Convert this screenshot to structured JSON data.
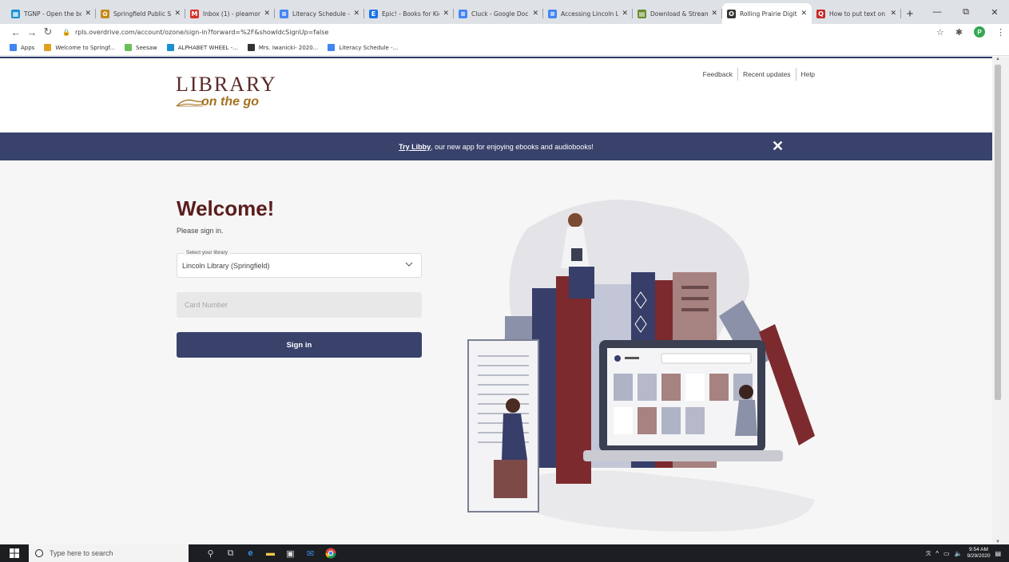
{
  "browser": {
    "tabs": [
      {
        "title": "TGNP - Open the bo",
        "color": "#1b8fd1",
        "glyph": "▦"
      },
      {
        "title": "Springfield Public Sc",
        "color": "#c58a1c",
        "glyph": "✿"
      },
      {
        "title": "Inbox (1) - pleamon",
        "color": "#d93025",
        "glyph": "M"
      },
      {
        "title": "Literacy Schedule -",
        "color": "#4285f4",
        "glyph": "≡"
      },
      {
        "title": "Epic! - Books for Kid",
        "color": "#1a73e8",
        "glyph": "E"
      },
      {
        "title": "Cluck - Google Doc",
        "color": "#4285f4",
        "glyph": "≡"
      },
      {
        "title": "Accessing Lincoln Li",
        "color": "#4285f4",
        "glyph": "≡"
      },
      {
        "title": "Download & Stream",
        "color": "#6a8c2c",
        "glyph": "▤"
      },
      {
        "title": "Rolling Prairie Digit",
        "color": "#333333",
        "glyph": "O"
      },
      {
        "title": "How to put text on",
        "color": "#c62828",
        "glyph": "Q"
      }
    ],
    "active_tab_index": 8,
    "new_tab": "+",
    "url": "rpls.overdrive.com/account/ozone/sign-in?forward=%2F&showIdcSignUp=false",
    "profile_initial": "P",
    "bookmarks": [
      {
        "label": "Apps",
        "color": "#4285f4"
      },
      {
        "label": "Welcome to Springf...",
        "color": "#e0a020"
      },
      {
        "label": "Seesaw",
        "color": "#6bbf59"
      },
      {
        "label": "ALPHABET WHEEL -...",
        "color": "#1b8fd1"
      },
      {
        "label": "Mrs. Iwanicki- 2020...",
        "color": "#333333"
      },
      {
        "label": "Literacy Schedule -...",
        "color": "#4285f4"
      }
    ]
  },
  "header": {
    "logo_top": "LIBRARY",
    "logo_bottom": "on the go",
    "links": [
      "Feedback",
      "Recent updates",
      "Help"
    ]
  },
  "banner": {
    "try_label": "Try Libby",
    "rest": ", our new app for enjoying ebooks and audiobooks!",
    "close": "✕"
  },
  "signin": {
    "title": "Welcome!",
    "subtitle": "Please sign in.",
    "select_label": "Select your library",
    "select_value": "Lincoln Library (Springfield)",
    "card_placeholder": "Card Number",
    "button": "Sign in"
  },
  "taskbar": {
    "search_placeholder": "Type here to search",
    "time": "9:54 AM",
    "date": "9/29/2020"
  }
}
